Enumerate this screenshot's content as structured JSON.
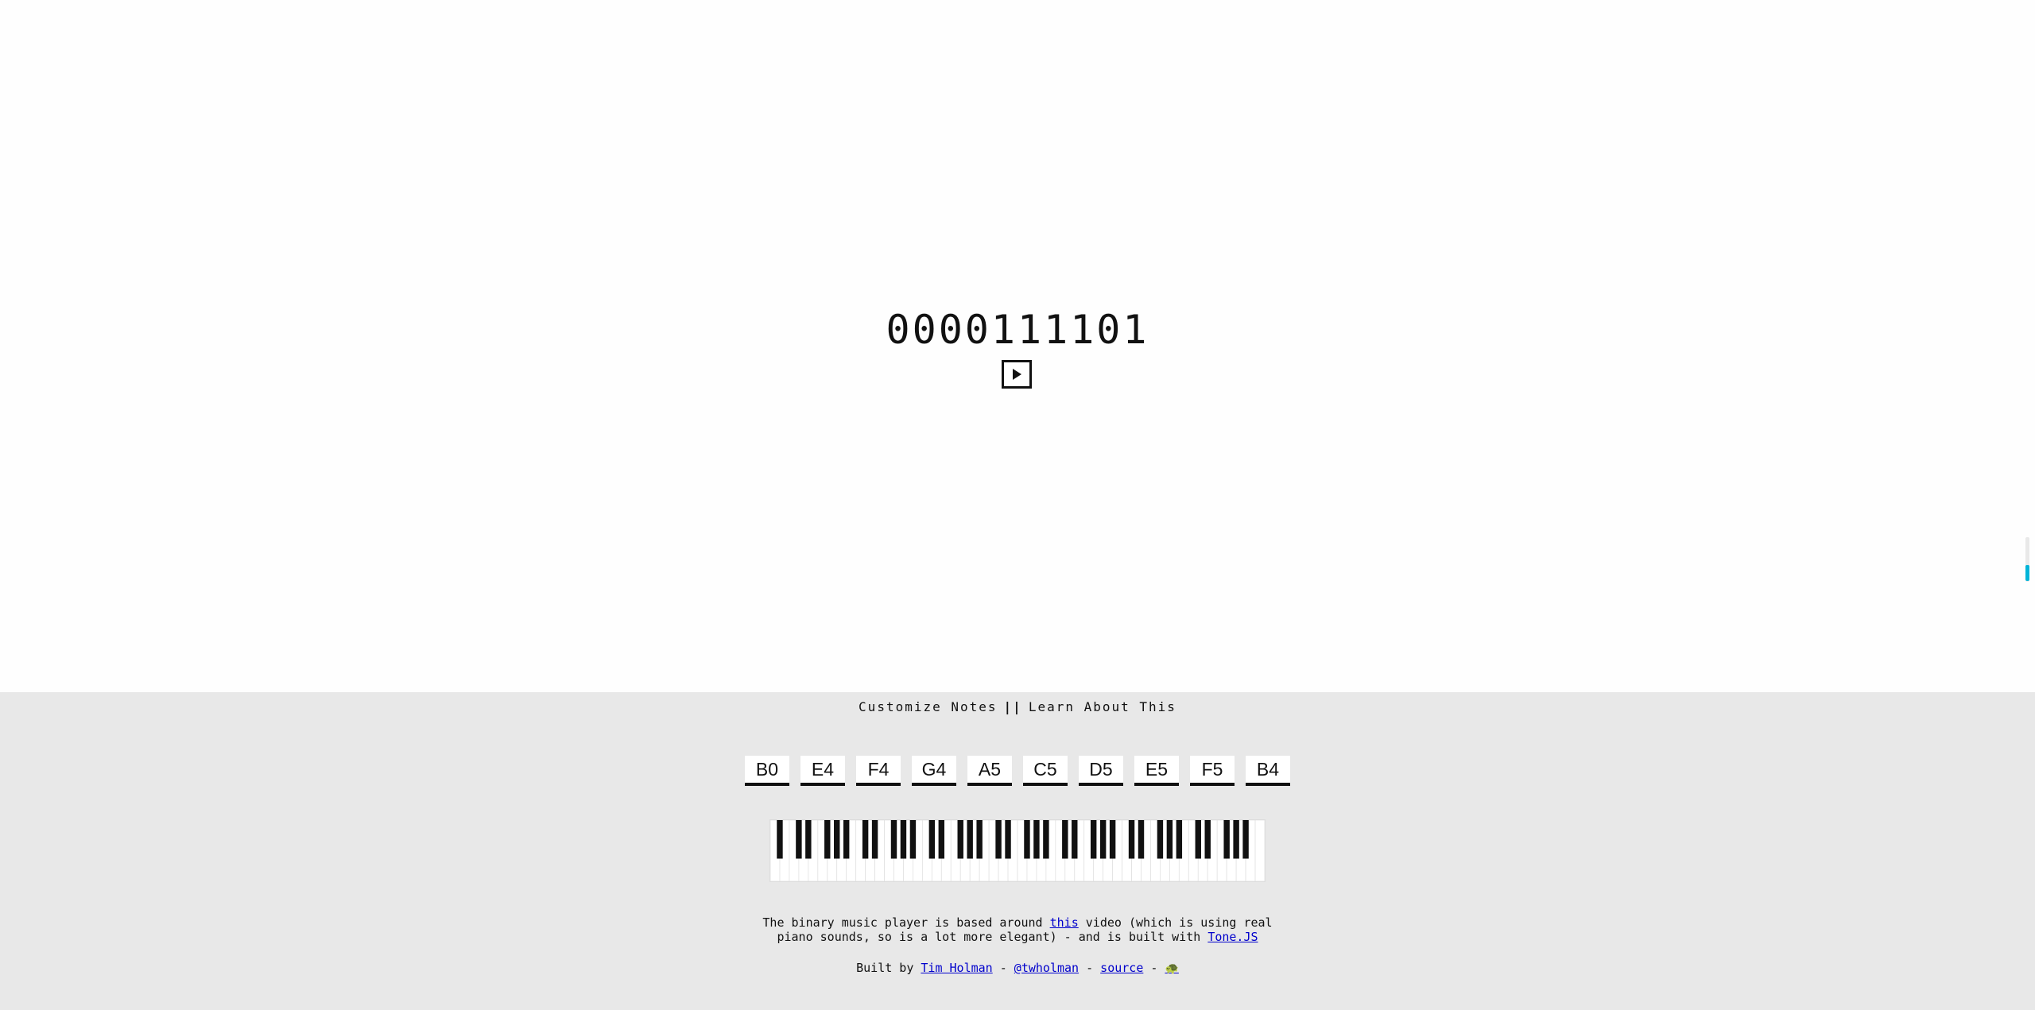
{
  "player": {
    "binary": "0000111101",
    "play_icon": "play-icon"
  },
  "nav": {
    "customize": "Customize Notes",
    "separator": "||",
    "learn": "Learn About This"
  },
  "notes": [
    "B0",
    "E4",
    "F4",
    "G4",
    "A5",
    "C5",
    "D5",
    "E5",
    "F5",
    "B4"
  ],
  "piano": {
    "white_keys": 52
  },
  "description": {
    "part1": "The binary music player is based around ",
    "link_this": "this",
    "part2": " video (which is using real",
    "part3": "piano sounds, so is a lot more elegant) - and is built with ",
    "link_tone": "Tone.JS"
  },
  "credits": {
    "prefix": "Built by ",
    "author": "Tim Holman",
    "dash1": " - ",
    "handle": "@twholman",
    "dash2": " - ",
    "source": "source",
    "dash3": " - ",
    "emoji": "🐢"
  },
  "colors": {
    "footer_bg": "#e8e8e8",
    "link": "#0000cc",
    "scroll_thumb": "#00b4d8"
  }
}
